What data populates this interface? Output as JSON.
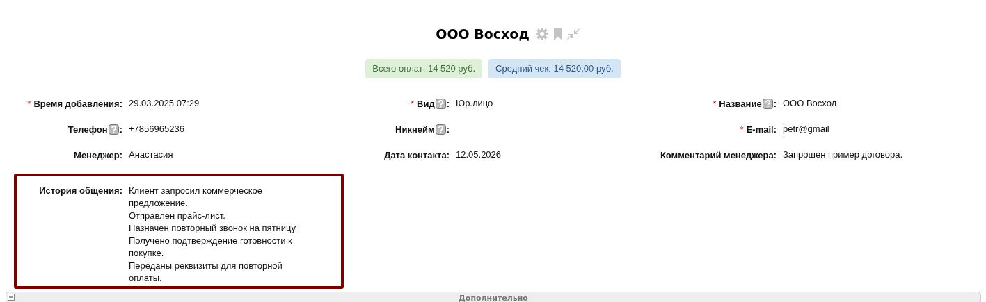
{
  "title": "ООО Восход",
  "stats": [
    {
      "text": "Всего оплат: 14 520 руб.",
      "color": "#dff0d8"
    },
    {
      "text": "Средний чек: 14 520,00 руб.",
      "color": "#d4e5f5"
    }
  ],
  "fields": [
    {
      "label": "Время добавления",
      "marker": "*",
      "colon": ":",
      "value": "29.03.2025 07:29"
    },
    {
      "label": "Вид",
      "marker": "*",
      "help": true,
      "colon": ":",
      "value": "Юр.лицо"
    },
    {
      "label": "Название",
      "marker": "*",
      "help": true,
      "colon": ":",
      "value": "ООО Восход"
    },
    {
      "label": "Телефон",
      "help": true,
      "colon": ":",
      "value": "+7856965236"
    },
    {
      "label": "Никнейм",
      "help": true,
      "colon": ":"
    },
    {
      "label": "E-mail",
      "marker": "*",
      "colon": ":",
      "value": "petr@gmail"
    },
    {
      "label": "Менеджер",
      "colon": ":",
      "value": "Анастасия"
    },
    {
      "label": "Дата контакта",
      "colon": ":",
      "value": "12.05.2026"
    },
    {
      "label": "Комментарий менеджера",
      "colon": ":",
      "value": "Запрошен пример договора."
    },
    {
      "label": "История общения",
      "colon": ":",
      "highlighted": true,
      "value_lines": [
        "Клиент запросил коммерческое предложение.",
        "Отправлен прайс-лист.",
        "Назначен повторный звонок на пятницу.",
        "Получено подтверждение готовности к покупке.",
        "Переданы реквизиты для повторной оплаты."
      ]
    }
  ],
  "section": {
    "title": "Дополнительно",
    "expanded": true
  }
}
